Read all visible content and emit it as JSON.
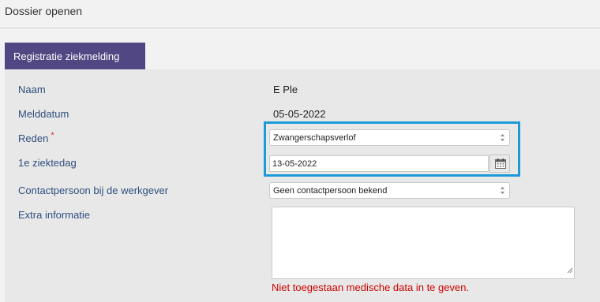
{
  "header": {
    "title": "Dossier openen"
  },
  "tab": {
    "label": "Registratie ziekmelding"
  },
  "form": {
    "naam": {
      "label": "Naam",
      "value": "E Ple"
    },
    "melddatum": {
      "label": "Melddatum",
      "value": "05-05-2022"
    },
    "reden": {
      "label": "Reden",
      "required_mark": "*",
      "selected": "Zwangerschapsverlof"
    },
    "ziektedag": {
      "label": "1e ziektedag",
      "value": "13-05-2022"
    },
    "contactpersoon": {
      "label": "Contactpersoon bij de werkgever",
      "selected": "Geen contactpersoon bekend"
    },
    "extra": {
      "label": "Extra informatie",
      "value": ""
    },
    "error": "Niet toegestaan medische data in te geven."
  },
  "icons": {
    "calendar": "calendar-icon",
    "select_arrows": "select-arrows-icon",
    "resize": "resize-handle-icon"
  },
  "colors": {
    "tab_bg": "#514783",
    "label": "#2e4f7e",
    "highlight": "#1d9ad8",
    "error": "#cc0000"
  }
}
